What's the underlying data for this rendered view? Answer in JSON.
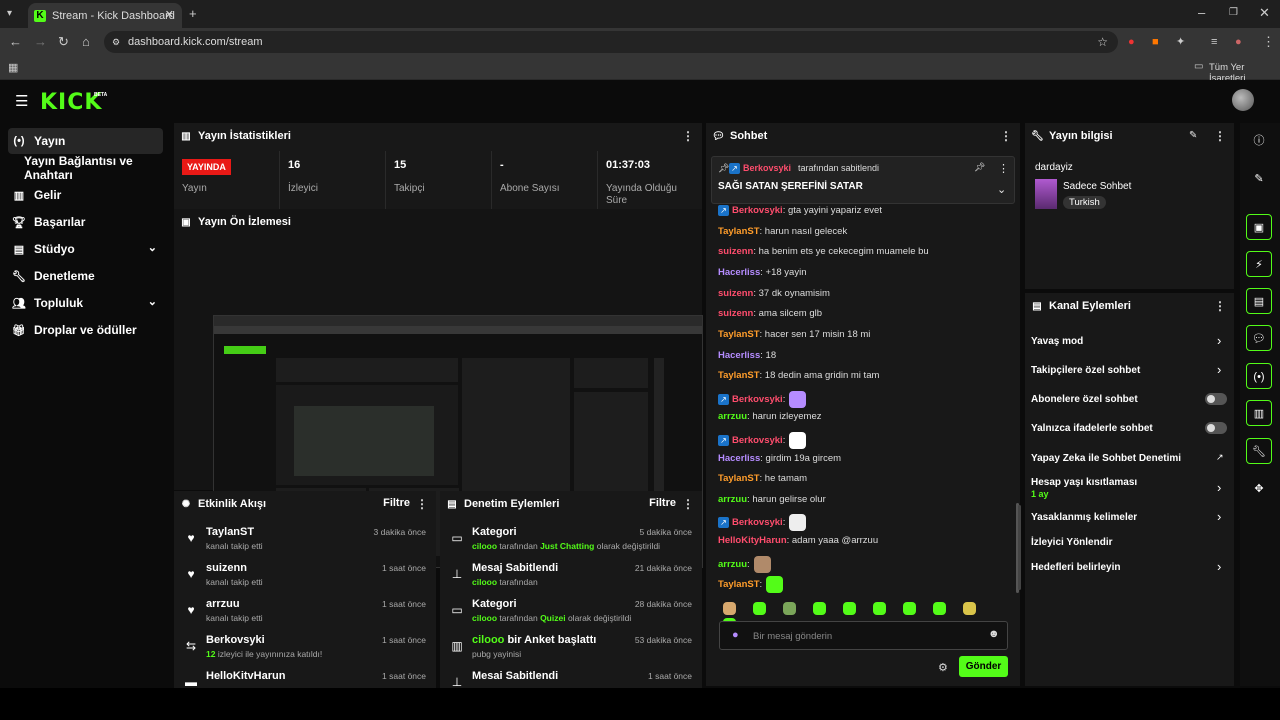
{
  "browser": {
    "tab_title": "Stream - Kick Dashboard",
    "url": "dashboard.kick.com/stream",
    "bookmarks_label": "Tüm Yer İşaretleri"
  },
  "app": {
    "logo": "KICK",
    "logo_badge": "BETA"
  },
  "sidebar": {
    "items": [
      {
        "label": "Yayın",
        "icon": "broadcast-icon"
      },
      {
        "label": "Yayın Bağlantısı ve Anahtarı"
      },
      {
        "label": "Gelir",
        "icon": "chart-icon"
      },
      {
        "label": "Başarılar",
        "icon": "trophy-icon"
      },
      {
        "label": "Stüdyo",
        "icon": "studio-icon"
      },
      {
        "label": "Denetleme",
        "icon": "wrench-icon"
      },
      {
        "label": "Topluluk",
        "icon": "people-icon"
      },
      {
        "label": "Droplar ve ödüller",
        "icon": "gift-icon"
      }
    ]
  },
  "stats": {
    "title": "Yayın İstatistikleri",
    "live_badge": "YAYINDA",
    "items": [
      {
        "value": "",
        "label": "Yayın"
      },
      {
        "value": "16",
        "label": "İzleyici"
      },
      {
        "value": "15",
        "label": "Takipçi"
      },
      {
        "value": "-",
        "label": "Abone Sayısı"
      },
      {
        "value": "01:37:03",
        "label": "Yayında Olduğu Süre"
      }
    ]
  },
  "preview": {
    "title": "Yayın Ön İzlemesi"
  },
  "activity": {
    "title": "Etkinlik Akışı",
    "filter": "Filtre",
    "items": [
      {
        "name": "TaylanST",
        "sub": "kanalı takip etti",
        "time": "3 dakika önce"
      },
      {
        "name": "suizenn",
        "sub": "kanalı takip etti",
        "time": "1 saat önce"
      },
      {
        "name": "arrzuu",
        "sub": "kanalı takip etti",
        "time": "1 saat önce"
      },
      {
        "name": "Berkovsyki",
        "sub_count": "12",
        "sub": "izleyici ile yayınınıza katıldı!",
        "time": "1 saat önce"
      },
      {
        "name": "HelloKitvHarun",
        "sub": "",
        "time": "1 saat önce"
      }
    ]
  },
  "mod_actions": {
    "title": "Denetim Eylemleri",
    "filter": "Filtre",
    "items": [
      {
        "title": "Kategori",
        "user": "cilooo",
        "mid": "tarafından",
        "hl": "Just Chatting",
        "tail": "olarak değiştirildi",
        "time": "5 dakika önce"
      },
      {
        "title": "Mesaj Sabitlendi",
        "user": "cilooo",
        "mid": "tarafından",
        "hl": "",
        "tail": "",
        "time": "21 dakika önce"
      },
      {
        "title": "Kategori",
        "user": "cilooo",
        "mid": "tarafından",
        "hl": "Quizei",
        "tail": "olarak değiştirildi",
        "time": "28 dakika önce"
      },
      {
        "title_user": "cilooo",
        "title": "bir Anket başlattı",
        "sub": "pubg yayinisi",
        "time": "53 dakika önce"
      },
      {
        "title": "Mesai Sabitlendi",
        "time": "1 saat önce"
      }
    ]
  },
  "chat": {
    "title": "Sohbet",
    "pinned_by": "Berkovsyki",
    "pinned_suffix": "tarafından sabitlendi",
    "pinned_text": "SAĞI SATAN ŞEREFİNİ SATAR",
    "messages": [
      {
        "user": "Berkovsyki",
        "color": "#ff4d6d",
        "badge": true,
        "text": ": gta yayini yapariz evet"
      },
      {
        "user": "TaylanST",
        "color": "#ff9d2b",
        "text": ": harun nasıl gelecek"
      },
      {
        "user": "suizenn",
        "color": "#ff4d6d",
        "text": ": ha benim ets ye cekecegim muamele bu"
      },
      {
        "user": "Hacerliss",
        "color": "#b58cff",
        "text": ": +18 yayin"
      },
      {
        "user": "suizenn",
        "color": "#ff4d6d",
        "text": ": 37 dk oynamisim"
      },
      {
        "user": "suizenn",
        "color": "#ff4d6d",
        "text": ": ama silcem glb"
      },
      {
        "user": "TaylanST",
        "color": "#ff9d2b",
        "text": ": hacer sen 17 misin 18 mi"
      },
      {
        "user": "Hacerliss",
        "color": "#b58cff",
        "text": ": 18"
      },
      {
        "user": "TaylanST",
        "color": "#ff9d2b",
        "text": ": 18 dedin ama gridin mi tam"
      },
      {
        "user": "Berkovsyki",
        "color": "#ff4d6d",
        "badge": true,
        "text": ":"
      },
      {
        "user": "arrzuu",
        "color": "#53fc18",
        "text": ": harun izleyemez"
      },
      {
        "user": "Berkovsyki",
        "color": "#ff4d6d",
        "badge": true,
        "text": ":"
      },
      {
        "user": "Hacerliss",
        "color": "#b58cff",
        "text": ": girdim 19a gircem"
      },
      {
        "user": "TaylanST",
        "color": "#ff9d2b",
        "text": ": he tamam"
      },
      {
        "user": "arrzuu",
        "color": "#53fc18",
        "text": ": harun gelirse olur"
      },
      {
        "user": "Berkovsyki",
        "color": "#ff4d6d",
        "badge": true,
        "text": ":"
      },
      {
        "user": "HelloKityHarun",
        "color": "#ff4d6d",
        "text": ": adam yaaa @arrzuu"
      },
      {
        "user": "arrzuu",
        "color": "#53fc18",
        "text": ":"
      },
      {
        "user": "TaylanST",
        "color": "#ff9d2b",
        "text": ":"
      }
    ],
    "input_placeholder": "Bir mesaj gönderin",
    "send": "Gönder"
  },
  "stream_info": {
    "title": "Yayın bilgisi",
    "stream_title": "dardayiz",
    "category": "Sadece Sohbet",
    "tag": "Turkish"
  },
  "channel_actions": {
    "title": "Kanal Eylemleri",
    "items": [
      {
        "label": "Yavaş mod",
        "control": "arrow"
      },
      {
        "label": "Takipçilere özel sohbet",
        "control": "arrow"
      },
      {
        "label": "Abonelere özel sohbet",
        "control": "toggle"
      },
      {
        "label": "Yalnızca ifadelerle sohbet",
        "control": "toggle"
      },
      {
        "label": "Yapay Zeka ile Sohbet Denetimi",
        "control": "external"
      },
      {
        "label": "Hesap yaşı kısıtlaması",
        "sub": "1 ay",
        "control": "arrow"
      },
      {
        "label": "Yasaklanmış kelimeler",
        "control": "arrow"
      },
      {
        "label": "İzleyici Yönlendir",
        "control": "none"
      },
      {
        "label": "Hedefleri belirleyin",
        "control": "arrow"
      }
    ]
  },
  "colors": {
    "accent": "#53fc18",
    "live": "#e91916",
    "panel": "#181818"
  }
}
